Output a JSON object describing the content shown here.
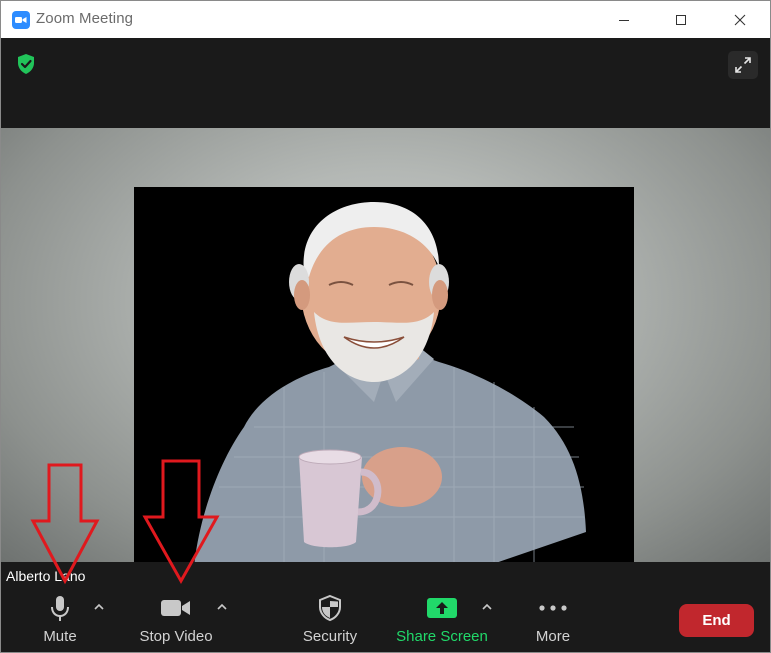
{
  "window": {
    "title": "Zoom Meeting"
  },
  "participant": {
    "name": "Alberto Lano"
  },
  "toolbar": {
    "mute_label": "Mute",
    "stop_video_label": "Stop Video",
    "security_label": "Security",
    "share_screen_label": "Share Screen",
    "more_label": "More",
    "end_label": "End"
  },
  "colors": {
    "accent_blue": "#2d8cff",
    "share_green": "#21d96a",
    "end_red": "#c1272d",
    "annotation_red": "#e0191e"
  },
  "icons": {
    "app": "zoom-logo-icon",
    "encryption": "shield-check-icon",
    "fullscreen": "fullscreen-icon",
    "mute": "microphone-icon",
    "video": "video-camera-icon",
    "security": "shield-icon",
    "share": "share-screen-icon",
    "more": "more-dots-icon"
  }
}
